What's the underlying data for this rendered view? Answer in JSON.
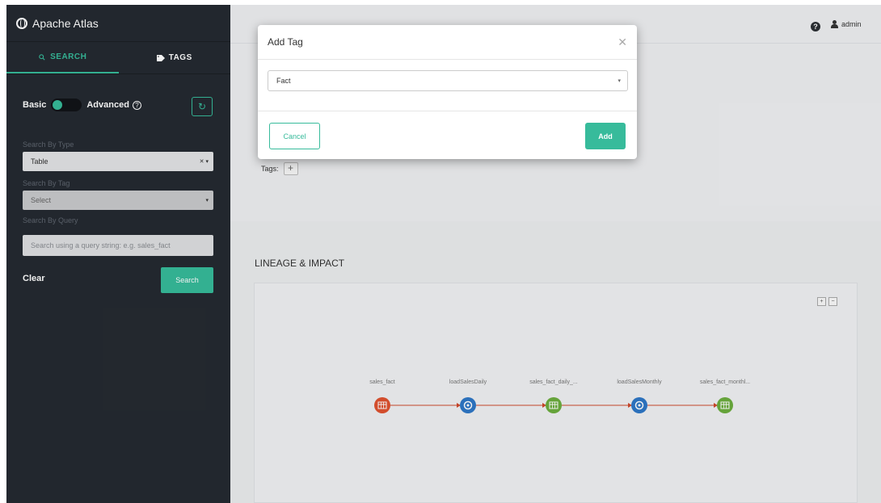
{
  "brand": {
    "title": "Apache Atlas"
  },
  "sidebar": {
    "tabs": [
      {
        "label": "SEARCH",
        "icon": "search-icon",
        "active": true
      },
      {
        "label": "TAGS",
        "icon": "tag-icon",
        "active": false
      }
    ],
    "basic_label": "Basic",
    "advanced_label": "Advanced",
    "search_by_type_label": "Search By Type",
    "type_value": "Table",
    "search_by_tag_label": "Search By Tag",
    "tag_value": "Select",
    "search_by_query_label": "Search By Query",
    "query_placeholder": "Search using a query string: e.g. sales_fact",
    "clear_label": "Clear",
    "search_label": "Search"
  },
  "header": {
    "user_label": "admin"
  },
  "details": {
    "tags_label": "Tags:"
  },
  "lineage": {
    "title": "LINEAGE & IMPACT",
    "nodes": [
      {
        "label": "sales_fact",
        "kind": "table-origin",
        "color": "#e0522f"
      },
      {
        "label": "loadSalesDaily",
        "kind": "process",
        "color": "#2e78c7"
      },
      {
        "label": "sales_fact_daily_...",
        "kind": "table",
        "color": "#6cae3e"
      },
      {
        "label": "loadSalesMonthly",
        "kind": "process",
        "color": "#2e78c7"
      },
      {
        "label": "sales_fact_monthl...",
        "kind": "table",
        "color": "#6cae3e"
      }
    ],
    "edge_color": "#d04a2c"
  },
  "modal": {
    "title": "Add Tag",
    "selected_tag": "Fact",
    "cancel_label": "Cancel",
    "add_label": "Add"
  },
  "colors": {
    "accent": "#37bb9b",
    "sidebar_bg": "#252a31"
  }
}
